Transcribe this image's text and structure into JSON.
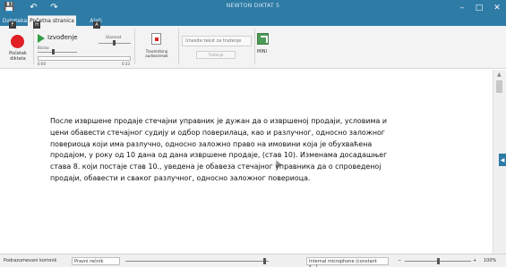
{
  "app": {
    "title": "NEWTON DIKTAT 5",
    "qat_icons": [
      "save-icon",
      "undo-icon",
      "redo-icon"
    ],
    "window_controls": [
      "minimize-icon",
      "maximize-icon",
      "close-icon"
    ]
  },
  "tabs": [
    {
      "label": "Datoteka",
      "active": false
    },
    {
      "label": "Početna stranica",
      "active": true
    },
    {
      "label": "Alati",
      "active": false
    }
  ],
  "key_badges": [
    "F",
    "H",
    "A"
  ],
  "ribbon": {
    "record_label": "Početak diktata",
    "play_label": "Izvođenje",
    "speed_label": "Brzina",
    "volume_label": "Glasnost",
    "time_start": "0:00",
    "time_end": "0:33",
    "transcribe_label": "Transkribiraj audiosnimak",
    "search_placeholder": "Unesite tekst za traženje",
    "search_button": "Traženje",
    "mini_label": "MINI"
  },
  "document": {
    "text": "После извршене продаје стечајни управник је дужан да о извршеној продаји, условима и\nцени обавести стечајног судију и одбор поверилаца, као и разлучног, односно заложног\nповериоца који има разлучно, односно заложно право на имовини која је обухваћена\nпродајом, у року од 10 дана од дана извршене продаје, (став 10). Изменама досадашњег\nстава 8. који постаје став 10., уведена је обавеза стечајног управника да о спроведеној\nпродаји, обавести и сваког разлучног, односно заложног повериоца."
  },
  "statusbar": {
    "profile_label": "Podrazumevani korisnik",
    "vocabulary_value": "Pravni rečnik",
    "microphone_label": "Internal microphone (constant s...)",
    "zoom_value": "100%"
  }
}
